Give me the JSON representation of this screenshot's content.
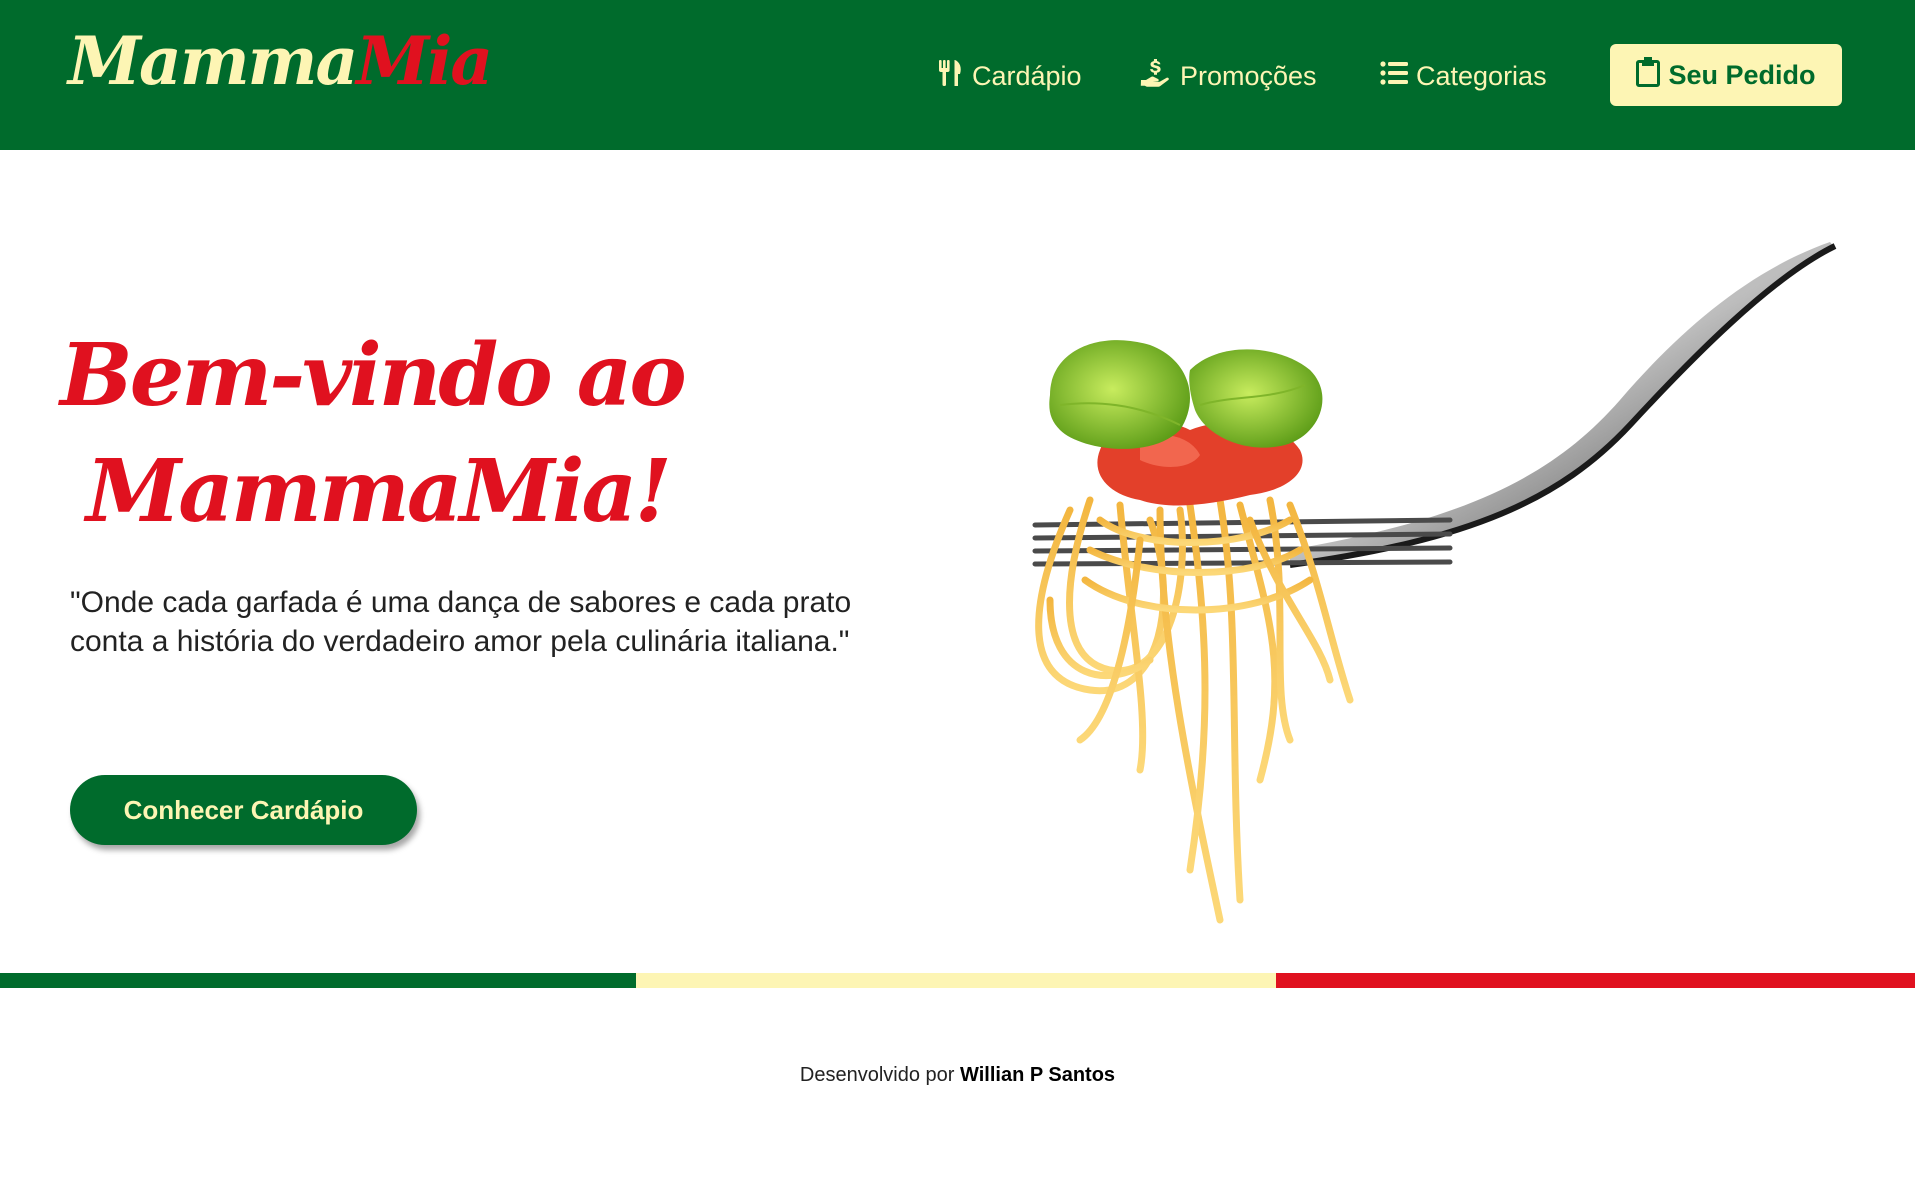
{
  "brand": {
    "logo_part1": "Mamma",
    "logo_part2": "Mia"
  },
  "nav": {
    "items": [
      {
        "label": "Cardápio",
        "icon": "utensils-icon"
      },
      {
        "label": "Promoções",
        "icon": "hand-dollar-icon"
      },
      {
        "label": "Categorias",
        "icon": "list-icon"
      }
    ],
    "order_button": {
      "label": "Seu Pedido",
      "icon": "clipboard-icon"
    }
  },
  "hero": {
    "title_line1": "Bem-vindo ao",
    "title_line2": "MammaMia!",
    "tagline": "\"Onde cada garfada é uma dança de sabores e cada prato conta a história do verdadeiro amor pela culinária italiana.\"",
    "cta_label": "Conhecer Cardápio",
    "image": "spaghetti-on-fork-image"
  },
  "footer": {
    "prefix": "Desenvolvido por",
    "author": "Willian P Santos"
  },
  "colors": {
    "green": "#006b2c",
    "cream": "#fdf5b4",
    "red": "#e0111f"
  }
}
